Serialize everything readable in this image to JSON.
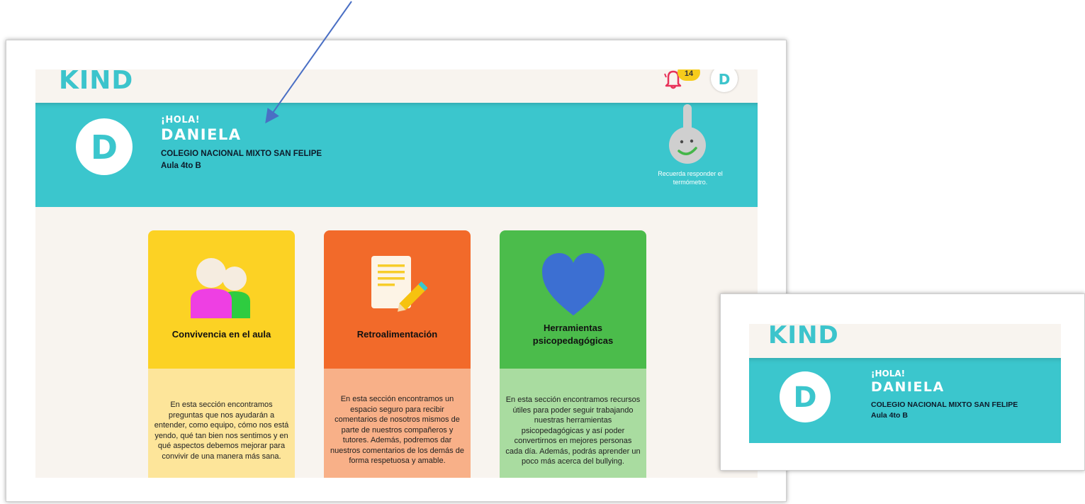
{
  "app": {
    "logo": "KIND",
    "notifications_count": "14",
    "user_initial": "D"
  },
  "hero": {
    "avatar_initial": "D",
    "greeting": "¡HOLA!",
    "name": "DANIELA",
    "school": "COLEGIO NACIONAL MIXTO SAN FELIPE",
    "classroom": "Aula 4to B",
    "thermometer_hint": "Recuerda responder el termómetro."
  },
  "cards": [
    {
      "title": "Convivencia en el aula",
      "icon": "people-icon",
      "description": "En esta sección encontramos preguntas que nos ayudarán a entender, como equipo, cómo nos está yendo, qué tan bien nos sentimos y en qué aspectos debemos mejorar para convivir de una manera más sana."
    },
    {
      "title": "Retroalimentación",
      "icon": "document-pencil-icon",
      "description": "En esta sección encontramos un espacio seguro para recibir comentarios de nosotros mismos de parte de nuestros compañeros y tutores. Además, podremos dar nuestros comentarios de los demás de forma respetuosa y amable."
    },
    {
      "title": "Herramientas psicopedagógicas",
      "icon": "heart-icon",
      "description": "En esta sección encontramos recursos útiles para poder seguir trabajando nuestras herramientas psicopedagógicas y así poder convertirnos en mejores personas cada día. Además, podrás aprender un poco más acerca del bullying."
    }
  ],
  "zoom_inset": {
    "logo": "KIND",
    "avatar_initial": "D",
    "greeting": "¡HOLA!",
    "name": "DANIELA",
    "school": "COLEGIO NACIONAL MIXTO SAN FELIPE",
    "classroom": "Aula 4to B"
  },
  "colors": {
    "teal": "#3bc6cd",
    "yellow": "#fcd224",
    "orange": "#f26a2a",
    "green": "#4bbc4b",
    "arrow": "#4a6fc4"
  }
}
